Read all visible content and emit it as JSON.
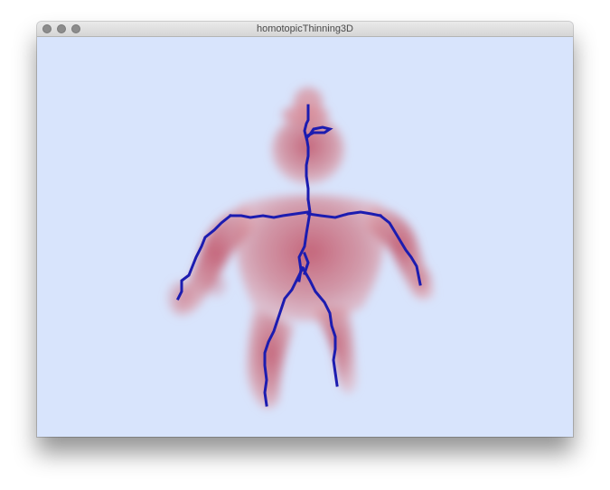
{
  "window": {
    "title": "homotopicThinning3D"
  },
  "titlebar_controls": [
    {
      "name": "close",
      "icon": "circle-icon"
    },
    {
      "name": "minimize",
      "icon": "circle-icon"
    },
    {
      "name": "zoom",
      "icon": "circle-icon"
    }
  ],
  "colors": {
    "canvas_background": "#d8e4fc",
    "volume_body": "#c96c79",
    "skeleton": "#1c1cb0",
    "traffic_light": "#8c8c8c"
  }
}
